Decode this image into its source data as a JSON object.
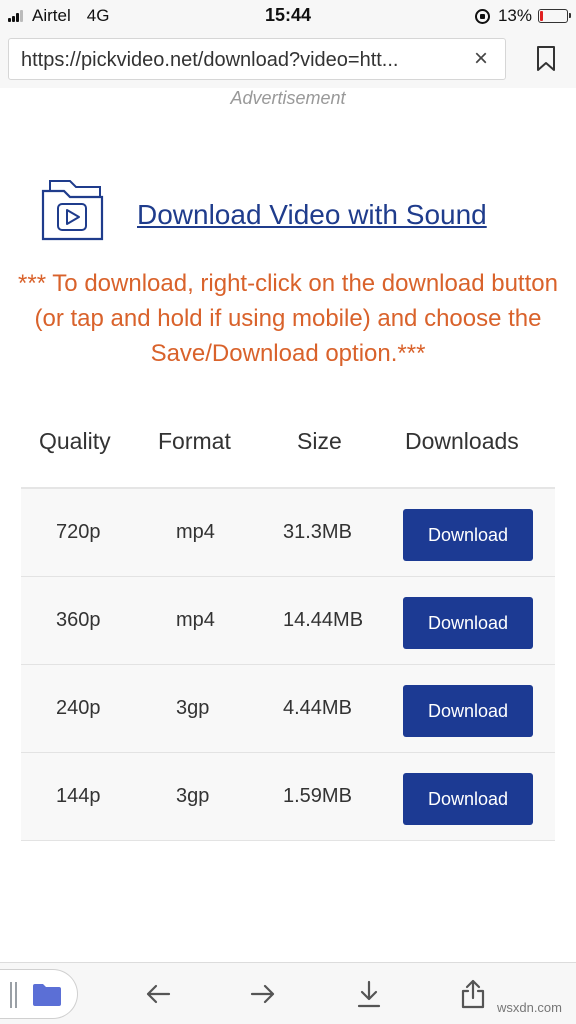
{
  "status_bar": {
    "carrier": "Airtel",
    "network": "4G",
    "time": "15:44",
    "battery_percent": "13%",
    "battery_level": 0.13,
    "battery_color": "#e02020"
  },
  "browser": {
    "url": "https://pickvideo.net/download?video=htt...",
    "clear_icon": "×"
  },
  "page": {
    "advertisement_label": "Advertisement",
    "heading": "Download Video with Sound",
    "instruction": "*** To download, right-click on the download button (or tap and hold if using mobile) and choose the Save/Download option.***",
    "accent_color": "#1c3a93",
    "instruction_color": "#d9622b"
  },
  "table": {
    "headers": {
      "quality": "Quality",
      "format": "Format",
      "size": "Size",
      "downloads": "Downloads"
    },
    "rows": [
      {
        "quality": "720p",
        "format": "mp4",
        "size": "31.3MB",
        "button": "Download"
      },
      {
        "quality": "360p",
        "format": "mp4",
        "size": "14.44MB",
        "button": "Download"
      },
      {
        "quality": "240p",
        "format": "3gp",
        "size": "4.44MB",
        "button": "Download"
      },
      {
        "quality": "144p",
        "format": "3gp",
        "size": "1.59MB",
        "button": "Download"
      }
    ]
  },
  "toolbar": {
    "icons": [
      "tabs-icon",
      "back-arrow-icon",
      "forward-arrow-icon",
      "download-icon",
      "share-icon"
    ]
  },
  "watermark": "wsxdn.com"
}
